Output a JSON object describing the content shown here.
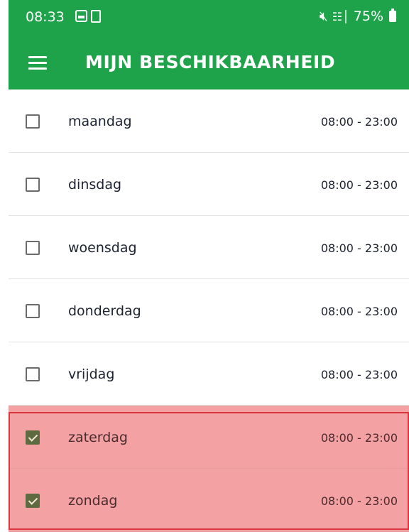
{
  "status_bar": {
    "time": "08:33",
    "battery": "75%"
  },
  "app_bar": {
    "title": "MIJN BESCHIKBAARHEID"
  },
  "colors": {
    "brand_green": "#1fa34a",
    "selected_row": "#f3a1a2",
    "selection_border": "#d9363e",
    "checkbox_checked": "#5e6a3f"
  },
  "availability": [
    {
      "day": "maandag",
      "hours": "08:00 - 23:00",
      "checked": false
    },
    {
      "day": "dinsdag",
      "hours": "08:00 - 23:00",
      "checked": false
    },
    {
      "day": "woensdag",
      "hours": "08:00 - 23:00",
      "checked": false
    },
    {
      "day": "donderdag",
      "hours": "08:00 - 23:00",
      "checked": false
    },
    {
      "day": "vrijdag",
      "hours": "08:00 - 23:00",
      "checked": false
    },
    {
      "day": "zaterdag",
      "hours": "08:00 - 23:00",
      "checked": true
    },
    {
      "day": "zondag",
      "hours": "08:00 - 23:00",
      "checked": true
    }
  ]
}
